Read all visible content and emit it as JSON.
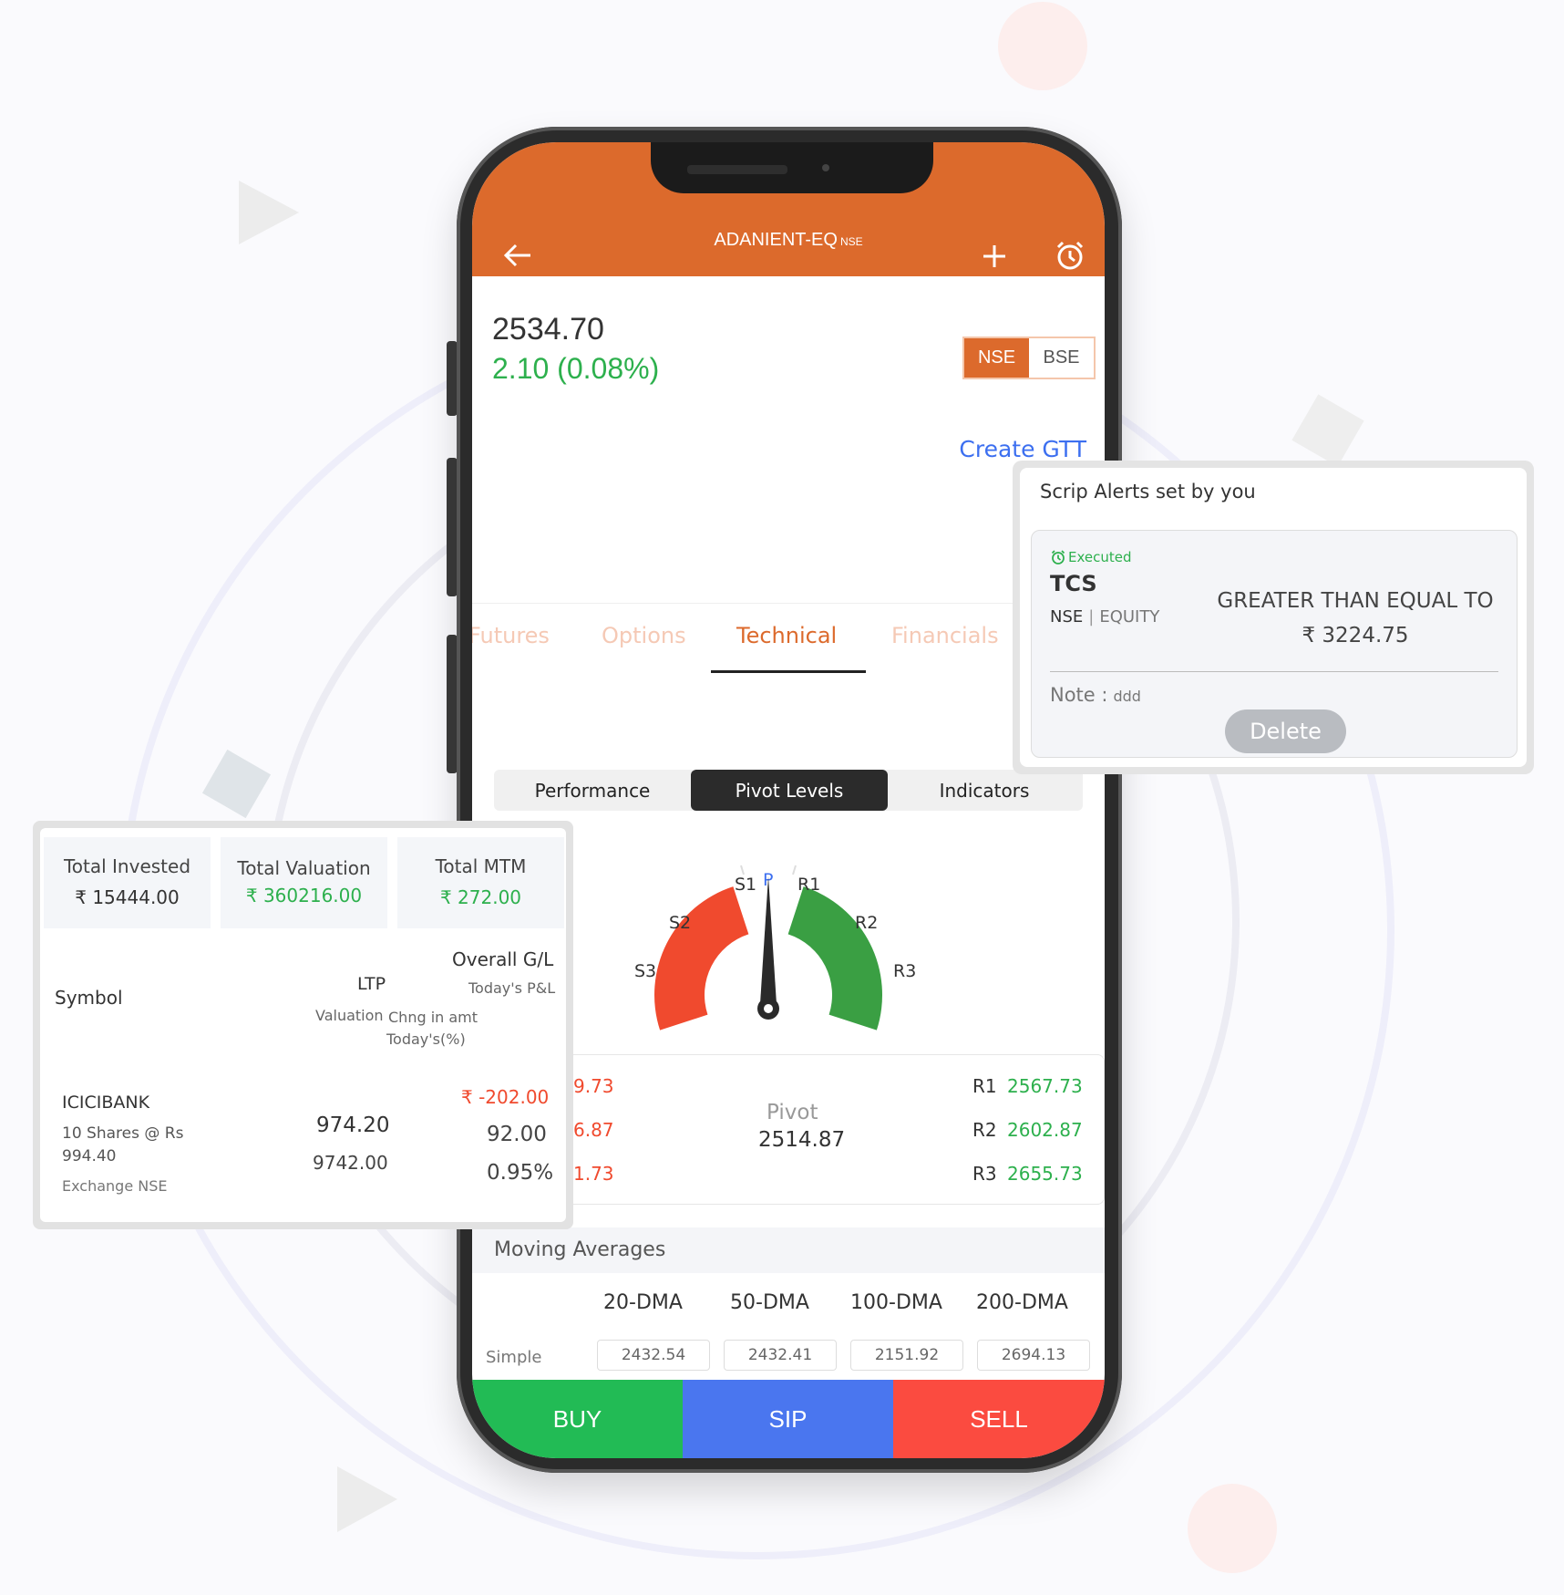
{
  "app": {
    "header": {
      "symbol": "ADANIENT-EQ",
      "exchange_tag": "NSE",
      "back_icon": "arrow-left-icon",
      "add_icon": "plus-icon",
      "alarm_icon": "alarm-clock-icon"
    },
    "quote": {
      "price": "2534.70",
      "change": "2.10 (0.08%)",
      "exchanges": [
        {
          "label": "NSE",
          "selected": true
        },
        {
          "label": "BSE",
          "selected": false
        }
      ],
      "create_gtt": "Create GTT"
    },
    "tabs": [
      {
        "label": "Futures",
        "active": false
      },
      {
        "label": "Options",
        "active": false
      },
      {
        "label": "Technical",
        "active": true
      },
      {
        "label": "Financials",
        "active": false
      }
    ],
    "subtabs": [
      {
        "label": "Performance",
        "active": false
      },
      {
        "label": "Pivot Levels",
        "active": true
      },
      {
        "label": "Indicators",
        "active": false
      }
    ],
    "gauge": {
      "labels": {
        "S3": "S3",
        "S2": "S2",
        "S1": "S1",
        "P": "P",
        "R1": "R1",
        "R2": "R2",
        "R3": "R3"
      },
      "needle_position": "P",
      "colors": {
        "support": "#f04a2e",
        "resistance": "#3a9f43",
        "pivot_label": "#3c6ff0"
      }
    },
    "pivot": {
      "supports": [
        "9.73",
        "6.87",
        "1.73"
      ],
      "pivot_label": "Pivot",
      "pivot_value": "2514.87",
      "resistances": [
        {
          "label": "R1",
          "value": "2567.73"
        },
        {
          "label": "R2",
          "value": "2602.87"
        },
        {
          "label": "R3",
          "value": "2655.73"
        }
      ]
    },
    "moving_averages": {
      "title": "Moving Averages",
      "columns": [
        "20-DMA",
        "50-DMA",
        "100-DMA",
        "200-DMA"
      ],
      "rows": [
        {
          "label": "Simple",
          "values": [
            "2432.54",
            "2432.41",
            "2151.92",
            "2694.13"
          ]
        }
      ]
    },
    "actions": [
      {
        "label": "BUY",
        "color": "#22bb55"
      },
      {
        "label": "SIP",
        "color": "#4a76ef"
      },
      {
        "label": "SELL",
        "color": "#fb4b40"
      }
    ]
  },
  "alerts_card": {
    "title": "Scrip Alerts set by you",
    "status": "Executed",
    "symbol": "TCS",
    "exchange": "NSE",
    "segment": "EQUITY",
    "condition": "GREATER THAN EQUAL TO",
    "target": "₹ 3224.75",
    "note_label": "Note :",
    "note_value": "ddd",
    "delete_label": "Delete"
  },
  "portfolio_card": {
    "totals": [
      {
        "label": "Total Invested",
        "value": "₹ 15444.00",
        "color": "#333333"
      },
      {
        "label": "Total Valuation",
        "value": "₹ 360216.00",
        "color": "#2db04d"
      },
      {
        "label": "Total MTM",
        "value": "₹ 272.00",
        "color": "#2db04d"
      }
    ],
    "headers": {
      "symbol": "Symbol",
      "ltp": "LTP",
      "valuation": "Valuation",
      "chng_amt": "Chng in amt",
      "todays_pct": "Today's(%)",
      "overall_gl": "Overall G/L",
      "todays_pl": "Today's P&L"
    },
    "rows": [
      {
        "symbol": "ICICIBANK",
        "qty_line1": "10 Shares @ Rs",
        "qty_line2": "994.40",
        "exchange": "Exchange NSE",
        "ltp": "974.20",
        "valuation": "9742.00",
        "overall_gl": "₹ -202.00",
        "chng_amt": "92.00",
        "todays_pct": "0.95%"
      }
    ]
  }
}
